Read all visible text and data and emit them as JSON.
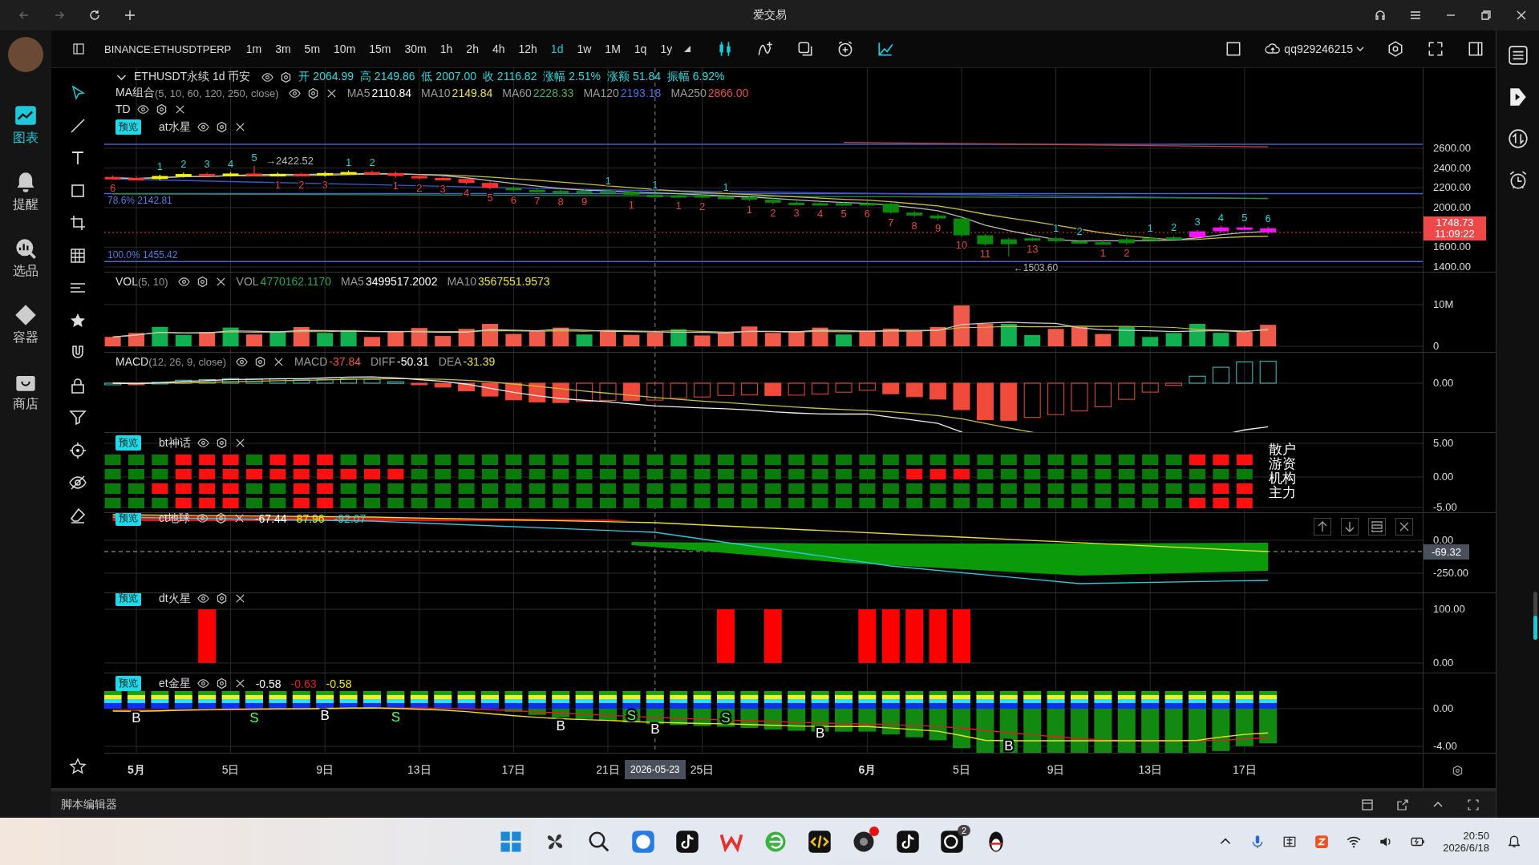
{
  "window": {
    "title": "爱交易"
  },
  "app_sidebar": [
    {
      "label": "图表",
      "selected": true
    },
    {
      "label": "提醒",
      "selected": false
    },
    {
      "label": "选品",
      "selected": false
    },
    {
      "label": "容器",
      "selected": false
    },
    {
      "label": "商店",
      "selected": false
    }
  ],
  "toolbar": {
    "symbol": "BINANCE:ETHUSDTPERP",
    "account": "qq929246215",
    "intervals": [
      {
        "label": "1m",
        "selected": false
      },
      {
        "label": "3m",
        "selected": false
      },
      {
        "label": "5m",
        "selected": false
      },
      {
        "label": "10m",
        "selected": false
      },
      {
        "label": "15m",
        "selected": false
      },
      {
        "label": "30m",
        "selected": false
      },
      {
        "label": "1h",
        "selected": false
      },
      {
        "label": "2h",
        "selected": false
      },
      {
        "label": "4h",
        "selected": false
      },
      {
        "label": "12h",
        "selected": false
      },
      {
        "label": "1d",
        "selected": true
      },
      {
        "label": "1w",
        "selected": false
      },
      {
        "label": "1M",
        "selected": false
      },
      {
        "label": "1q",
        "selected": false
      },
      {
        "label": "1y",
        "selected": false
      }
    ]
  },
  "chart": {
    "symbol_legend": {
      "title": "ETHUSDT永续 1d 币安",
      "stats": [
        {
          "label": "开",
          "value": "2064.99"
        },
        {
          "label": "高",
          "value": "2149.86"
        },
        {
          "label": "低",
          "value": "2007.00"
        },
        {
          "label": "收",
          "value": "2116.82"
        },
        {
          "label": "涨幅",
          "value": "2.51%"
        },
        {
          "label": "涨额",
          "value": "51.84"
        },
        {
          "label": "振幅",
          "value": "6.92%"
        }
      ]
    },
    "panes": [
      {
        "kind": "price",
        "legends": [
          {
            "name": "MA组合",
            "params": "(5, 10, 60, 120, 250, close)",
            "values": [
              {
                "label": "MA5",
                "value": "2110.84",
                "color": "#ffffff"
              },
              {
                "label": "MA10",
                "value": "2149.84",
                "color": "#e8e040"
              },
              {
                "label": "MA60",
                "value": "2228.33",
                "color": "#4caf50"
              },
              {
                "label": "MA120",
                "value": "2193.18",
                "color": "#4a6fe0"
              },
              {
                "label": "MA250",
                "value": "2866.00",
                "color": "#e05050"
              }
            ]
          },
          {
            "name": "TD"
          },
          {
            "badge": "预览",
            "name": "at水星"
          }
        ],
        "axis": [
          "2600.00",
          "2400.00",
          "2200.00",
          "2000.00",
          "1600.00",
          "1400.00"
        ],
        "last_price": "1748.73",
        "countdown": "11:09:22",
        "high_mark": "→2422.52",
        "low_mark": "←1503.60",
        "fib_levels": [
          "78.6% 2142.81",
          "100.0% 1455.42"
        ],
        "td_marks": [
          {
            "text": "6",
            "kind": "down"
          },
          {
            "text": "1",
            "kind": "up"
          },
          {
            "text": "2",
            "kind": "up"
          },
          {
            "text": "3",
            "kind": "up"
          },
          {
            "text": "4",
            "kind": "up"
          },
          {
            "text": "5",
            "kind": "up"
          },
          {
            "text": "1",
            "kind": "down"
          },
          {
            "text": "2",
            "kind": "down"
          },
          {
            "text": "3",
            "kind": "down"
          },
          {
            "text": "1",
            "kind": "up"
          },
          {
            "text": "2",
            "kind": "up"
          },
          {
            "text": "1",
            "kind": "down"
          },
          {
            "text": "2",
            "kind": "down"
          },
          {
            "text": "3",
            "kind": "down"
          },
          {
            "text": "4",
            "kind": "down"
          },
          {
            "text": "5",
            "kind": "down"
          },
          {
            "text": "6",
            "kind": "down"
          },
          {
            "text": "7",
            "kind": "down"
          },
          {
            "text": "8",
            "kind": "down"
          },
          {
            "text": "9",
            "kind": "down"
          },
          {
            "text": "1",
            "kind": "up"
          },
          {
            "text": "1",
            "kind": "down"
          },
          {
            "text": "1",
            "kind": "up"
          },
          {
            "text": "1",
            "kind": "down"
          },
          {
            "text": "2",
            "kind": "down"
          },
          {
            "text": "1",
            "kind": "up"
          },
          {
            "text": "1",
            "kind": "down"
          },
          {
            "text": "2",
            "kind": "down"
          },
          {
            "text": "3",
            "kind": "down"
          },
          {
            "text": "4",
            "kind": "down"
          },
          {
            "text": "5",
            "kind": "down"
          },
          {
            "text": "6",
            "kind": "down"
          },
          {
            "text": "7",
            "kind": "down"
          },
          {
            "text": "8",
            "kind": "down"
          },
          {
            "text": "9",
            "kind": "down"
          },
          {
            "text": "10",
            "kind": "down"
          },
          {
            "text": "11",
            "kind": "down"
          },
          {
            "text": "13",
            "kind": "down"
          },
          {
            "text": "1",
            "kind": "up"
          },
          {
            "text": "2",
            "kind": "up"
          },
          {
            "text": "1",
            "kind": "down"
          },
          {
            "text": "2",
            "kind": "down"
          },
          {
            "text": "1",
            "kind": "up"
          },
          {
            "text": "2",
            "kind": "up"
          },
          {
            "text": "3",
            "kind": "up"
          },
          {
            "text": "4",
            "kind": "up"
          },
          {
            "text": "5",
            "kind": "up"
          },
          {
            "text": "6",
            "kind": "up"
          }
        ]
      },
      {
        "kind": "volume",
        "legends": [
          {
            "name": "VOL",
            "params": "(5, 10)",
            "values": [
              {
                "label": "VOL",
                "value": "4770162.1170",
                "color": "#26a65b"
              },
              {
                "label": "MA5",
                "value": "3499517.2002",
                "color": "#ffffff"
              },
              {
                "label": "MA10",
                "value": "3567551.9573",
                "color": "#e8e040"
              }
            ]
          }
        ],
        "axis": [
          "10M",
          "0"
        ]
      },
      {
        "kind": "macd",
        "legends": [
          {
            "name": "MACD",
            "params": "(12, 26, 9, close)",
            "values": [
              {
                "label": "MACD",
                "value": "-37.84",
                "color": "#f05a4a"
              },
              {
                "label": "DIFF",
                "value": "-50.31",
                "color": "#ffffff"
              },
              {
                "label": "DEA",
                "value": "-31.39",
                "color": "#e8e040"
              }
            ]
          }
        ],
        "axis": [
          "0.00"
        ]
      },
      {
        "kind": "bt",
        "legends": [
          {
            "badge": "预览",
            "name": "bt神话"
          }
        ],
        "axis": [
          "5.00",
          "0.00",
          "-5.00"
        ],
        "row_labels": [
          "散户",
          "游资",
          "机构",
          "主力"
        ]
      },
      {
        "kind": "ct",
        "legends": [
          {
            "badge": "预览",
            "name": "ct地球",
            "values": [
              {
                "value": "-67.44",
                "color": "#ffffff"
              },
              {
                "value": "87.96",
                "color": "#f0f000"
              },
              {
                "value": "-92.07",
                "color": "#30d0e0"
              }
            ]
          }
        ],
        "axis": [
          "0.00",
          "-250.00"
        ],
        "current_value": "-69.32"
      },
      {
        "kind": "dt",
        "legends": [
          {
            "badge": "预览",
            "name": "dt火星"
          }
        ],
        "axis": [
          "100.00",
          "0.00"
        ]
      },
      {
        "kind": "et",
        "legends": [
          {
            "badge": "预览",
            "name": "et金星",
            "values": [
              {
                "value": "-0.58",
                "color": "#ffffff"
              },
              {
                "value": "-0.63",
                "color": "#e02020"
              },
              {
                "value": "-0.58",
                "color": "#f0f000"
              }
            ]
          }
        ],
        "axis": [
          "0.00",
          "-4.00"
        ],
        "signals": [
          {
            "text": "B",
            "kind": "buy"
          },
          {
            "text": "S",
            "kind": "sell"
          },
          {
            "text": "B",
            "kind": "buy"
          },
          {
            "text": "S",
            "kind": "sell"
          },
          {
            "text": "B",
            "kind": "buy"
          },
          {
            "text": "S",
            "kind": "sell"
          },
          {
            "text": "B",
            "kind": "buy"
          },
          {
            "text": "S",
            "kind": "sell"
          },
          {
            "text": "B",
            "kind": "buy"
          },
          {
            "text": "B",
            "kind": "buy"
          }
        ]
      }
    ],
    "time_axis": [
      {
        "label": "5月",
        "kind": "month"
      },
      {
        "label": "5日",
        "kind": "day"
      },
      {
        "label": "9日",
        "kind": "day"
      },
      {
        "label": "13日",
        "kind": "day"
      },
      {
        "label": "17日",
        "kind": "day"
      },
      {
        "label": "21日",
        "kind": "day"
      },
      {
        "label": "25日",
        "kind": "day"
      },
      {
        "label": "6月",
        "kind": "month"
      },
      {
        "label": "5日",
        "kind": "day"
      },
      {
        "label": "9日",
        "kind": "day"
      },
      {
        "label": "13日",
        "kind": "day"
      },
      {
        "label": "17日",
        "kind": "day"
      }
    ],
    "crosshair": {
      "date": "2026-05-23"
    }
  },
  "script_bar": {
    "label": "脚本编辑器"
  },
  "taskbar": {
    "badge": "2",
    "time": "20:50",
    "date": "2026/6/18"
  }
}
